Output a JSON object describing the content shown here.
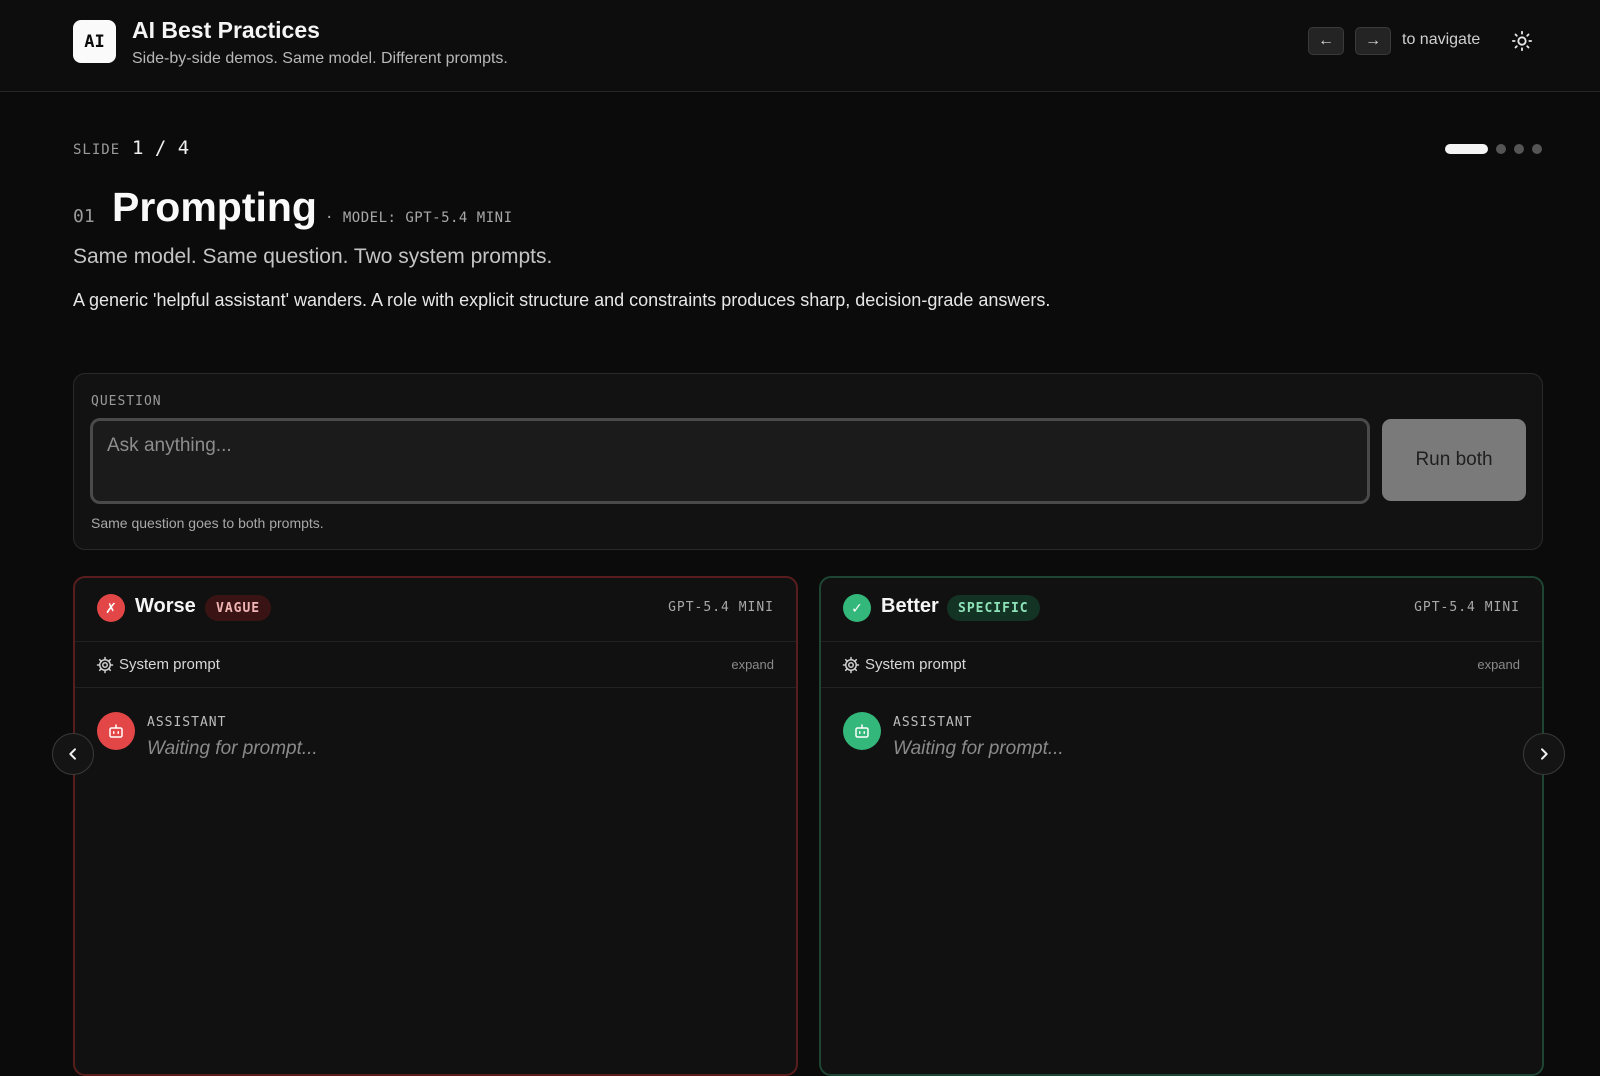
{
  "header": {
    "logo_text": "AI",
    "title": "AI Best Practices",
    "subtitle": "Side-by-side demos. Same model. Different prompts.",
    "prev_key": "←",
    "next_key": "→",
    "nav_hint": "to navigate",
    "theme_icon": "sun-icon"
  },
  "slide": {
    "label": "SLIDE",
    "count": "1 / 4",
    "current": 1,
    "total": 4,
    "number": "01",
    "title": "Prompting",
    "model_tag": "· MODEL: GPT-5.4 MINI",
    "subtitle": "Same model. Same question. Two system prompts.",
    "description": "A generic 'helpful assistant' wanders. A role with explicit structure and constraints produces sharp, decision-grade answers."
  },
  "question": {
    "label": "QUESTION",
    "placeholder": "Ask anything...",
    "value": "",
    "run_label": "Run both",
    "hint": "Same question goes to both prompts."
  },
  "panels": {
    "worse": {
      "status_icon": "✗",
      "title": "Worse",
      "badge": "VAGUE",
      "model": "GPT-5.4 MINI",
      "system_prompt_label": "System prompt",
      "expand_label": "expand",
      "role": "ASSISTANT",
      "message": "Waiting for prompt...",
      "accent": "#e34646"
    },
    "better": {
      "status_icon": "✓",
      "title": "Better",
      "badge": "SPECIFIC",
      "model": "GPT-5.4 MINI",
      "system_prompt_label": "System prompt",
      "expand_label": "expand",
      "role": "ASSISTANT",
      "message": "Waiting for prompt...",
      "accent": "#34b77a"
    }
  }
}
